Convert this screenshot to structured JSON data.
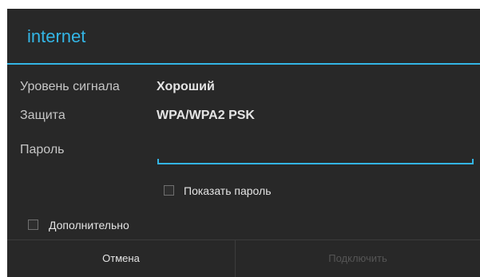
{
  "dialog": {
    "title": "internet",
    "signal": {
      "label": "Уровень сигнала",
      "value": "Хороший"
    },
    "security": {
      "label": "Защита",
      "value": "WPA/WPA2 PSK"
    },
    "password": {
      "label": "Пароль",
      "value": ""
    },
    "show_password": {
      "label": "Показать пароль",
      "checked": false
    },
    "advanced": {
      "label": "Дополнительно",
      "checked": false
    },
    "buttons": {
      "cancel": "Отмена",
      "connect": "Подключить"
    }
  },
  "colors": {
    "accent": "#33b5e5",
    "dialog_bg": "#282828",
    "disabled_text": "#555555"
  }
}
